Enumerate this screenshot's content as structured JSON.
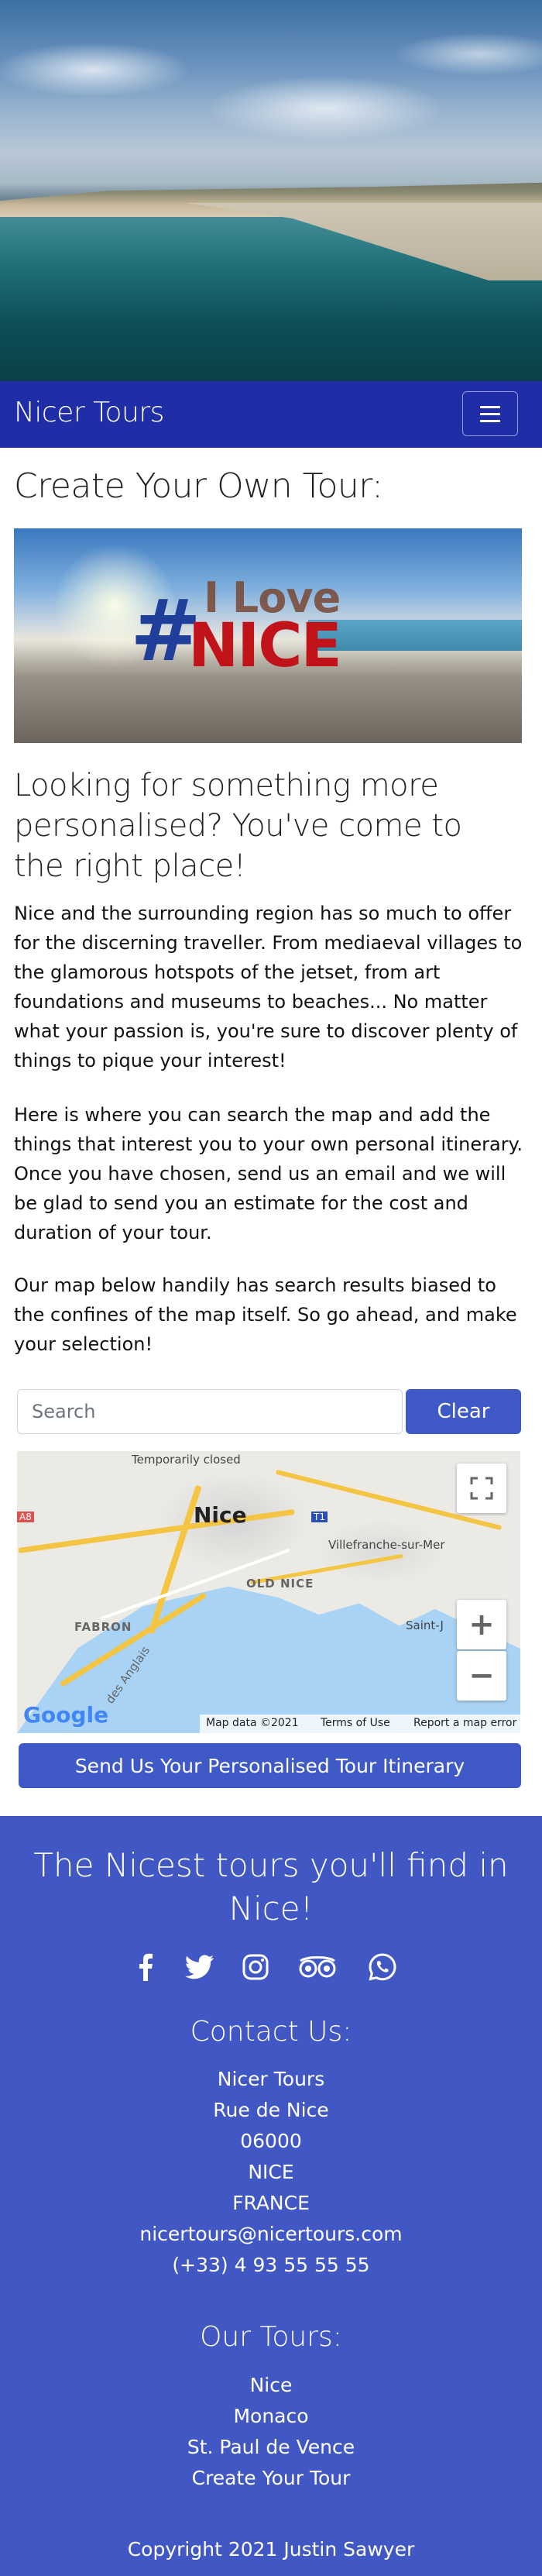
{
  "navbar": {
    "brand": "Nicer Tours",
    "toggle_icon": "hamburger-icon"
  },
  "main": {
    "title": "Create Your Own Tour:",
    "subtitle": "Looking for something more personalised? You've come to the right place!",
    "paragraphs": [
      "Nice and the surrounding region has so much to offer for the discerning traveller. From mediaeval villages to the glamorous hotspots of the jetset, from art foundations and museums to beaches... No matter what your passion is, you're sure to discover plenty of things to pique your interest!",
      "Here is where you can search the map and add the things that interest you to your own personal itinerary. Once you have chosen, send us an email and we will be glad to send you an estimate for the cost and duration of your tour.",
      "Our map below handily has search results biased to the confines of the map itself. So go ahead, and make your selection!"
    ],
    "photo_text": {
      "hash": "#",
      "ilove": "I Love",
      "nice": "NICE"
    },
    "search": {
      "placeholder": "Search",
      "value": "",
      "clear_label": "Clear"
    },
    "map": {
      "labels": {
        "temporarily_closed": "Temporarily closed",
        "nice": "Nice",
        "villefranche": "Villefranche-sur-Mer",
        "old_nice": "OLD NICE",
        "fabron": "FABRON",
        "saint_j": "Saint-J",
        "des_anglais": "des Anglais",
        "a8": "A8",
        "t1": "T1",
        "google": "Google"
      },
      "fullscreen_icon": "fullscreen-icon",
      "zoom_in_icon": "zoom-in-icon",
      "zoom_out_icon": "zoom-out-icon",
      "footer": {
        "map_data": "Map data ©2021",
        "terms": "Terms of Use",
        "report": "Report a map error"
      }
    },
    "send_label": "Send Us Your Personalised Tour Itinerary"
  },
  "footer": {
    "headline": "The Nicest tours you'll find in Nice!",
    "social_icons": [
      "facebook-icon",
      "twitter-icon",
      "instagram-icon",
      "tripadvisor-icon",
      "whatsapp-icon"
    ],
    "contact_heading": "Contact Us:",
    "contact_lines": [
      "Nicer Tours",
      "Rue de Nice",
      "06000",
      "NICE",
      "FRANCE",
      "nicertours@nicertours.com",
      "(+33) 4 93 55 55 55"
    ],
    "tours_heading": "Our Tours:",
    "tours": [
      "Nice",
      "Monaco",
      "St. Paul de Vence",
      "Create Your Tour"
    ],
    "copyright": "Copyright 2021 Justin Sawyer"
  },
  "colors": {
    "navbar": "#1f2ea6",
    "accent": "#3f5ac6",
    "footer": "#4158c4"
  }
}
